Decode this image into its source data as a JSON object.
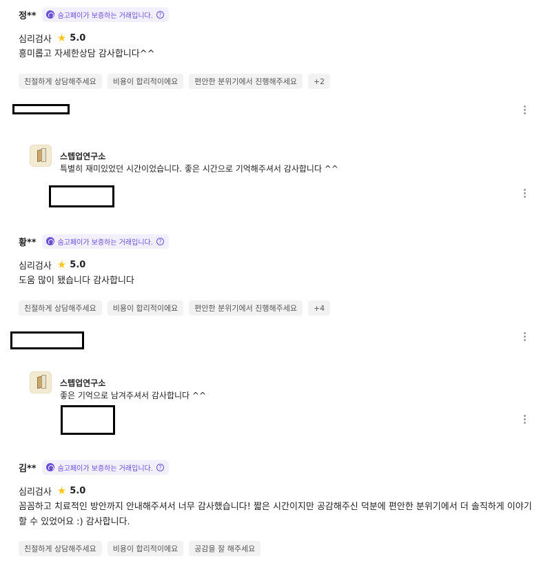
{
  "badge_text": "숨고페이가 보증하는 거래입니다.",
  "badge_help": "?",
  "reviews": [
    {
      "author": "정**",
      "service": "심리검사",
      "rating": "5.0",
      "content": "흥미롭고 자세한상담 감사합니다^^",
      "tags": [
        "친절하게 상담해주세요",
        "비용이 합리적이에요",
        "편안한 분위기에서 진행해주세요",
        "+2"
      ]
    },
    {
      "author": "황**",
      "service": "심리검사",
      "rating": "5.0",
      "content": "도움 많이 됐습니다 감사합니다",
      "tags": [
        "친절하게 상담해주세요",
        "비용이 합리적이에요",
        "편안한 분위기에서 진행해주세요",
        "+4"
      ]
    },
    {
      "author": "김**",
      "service": "심리검사",
      "rating": "5.0",
      "content": "꼼꼼하고 치료적인 방안까지 안내해주셔서 너무 감사했습니다! 짧은 시간이지만 공감해주신 덕분에 편안한 분위기에서 더 솔직하게 이야기할 수 있었어요 :) 감사합니다.",
      "tags": [
        "친절하게 상담해주세요",
        "비용이 합리적이에요",
        "공감을 잘 해주세요"
      ]
    }
  ],
  "replies": [
    {
      "name": "스텝업연구소",
      "text": "특별히 재미있었던 시간이었습니다. 좋은 시간으로 기억해주셔서 감사합니다 ^^"
    },
    {
      "name": "스텝업연구소",
      "text": "좋은 기억으로 남겨주셔서 감사합니다 ^^"
    }
  ],
  "icons": {
    "star": "star-icon",
    "more": "more-vertical-icon",
    "badge": "soomgo-pay-icon"
  },
  "colors": {
    "badge_bg": "#f2efff",
    "badge_text": "#6a4ed6",
    "star": "#ffc51a",
    "tag_bg": "#f2f2f2"
  }
}
